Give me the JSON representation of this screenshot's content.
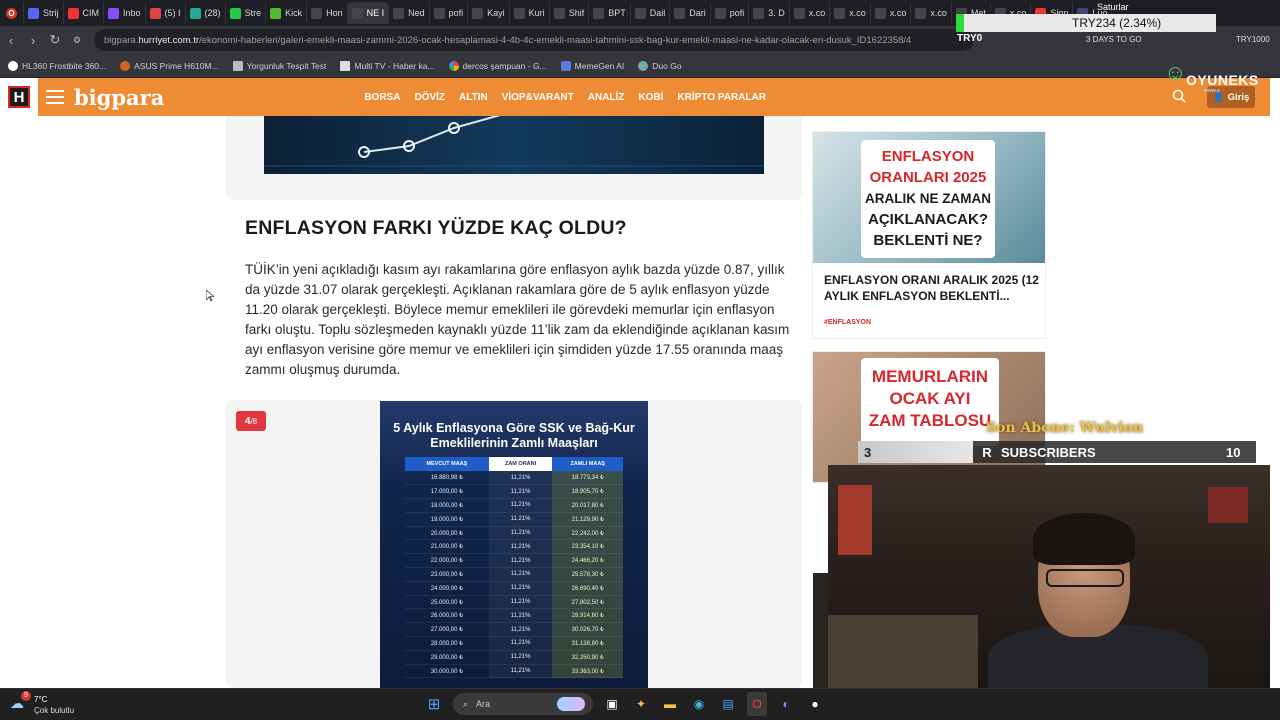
{
  "browser": {
    "tabs": [
      "Strij",
      "CIM",
      "Inbo",
      "(5) I",
      "(28)",
      "Stre",
      "Kick",
      "Hon",
      "NE I",
      "Ned",
      "pofi",
      "Kayi",
      "Kuri",
      "Shif",
      "BPT",
      "Dail",
      "Dari",
      "pofi",
      "3. D",
      "x.co",
      "x.co",
      "x.co",
      "x.co",
      "Met",
      "x.co",
      "Sign",
      "Luo"
    ],
    "url_prefix": "bigpara.",
    "url_domain": "hurriyet.com.tr",
    "url_path": "/ekonomi-haberleri/galeri-emekli-maasi-zammi-2026-ocak-hesaplamasi-4-4b-4c-emekli-maasi-tahmini-ssk-bag-kur-emekli-maasi-ne-kadar-olacak-en-dusuk_ID1622358/4",
    "bookmarks": [
      "HL360 Frostbite 360...",
      "ASUS Prime H610M...",
      "Yorgunluk Tespit Test",
      "Multi TV - Haber ka...",
      "dercos şampuan - G...",
      "MemeGen AI",
      "Duo Go"
    ]
  },
  "site": {
    "logo_letter": "H",
    "brand": "bigpara",
    "nav": [
      "BORSA",
      "DÖVİZ",
      "ALTIN",
      "VİOP&VARANT",
      "ANALİZ",
      "KOBİ",
      "KRİPTO PARALAR"
    ],
    "login": "Giriş"
  },
  "article": {
    "heading": "ENFLASYON FARKI YÜZDE KAÇ OLDU?",
    "paragraph": "TÜİK’in yeni açıkladığı kasım ayı rakamlarına göre enflasyon aylık bazda yüzde 0.87, yıllık da yüzde 31.07 olarak gerçekleşti. Açıklanan rakamlara göre de 5 aylık enflasyon yüzde 11.20 olarak gerçekleşti. Böylece memur emeklileri ile görevdeki memurlar için enflasyon farkı oluştu. Toplu sözleşmeden kaynaklı yüzde 11’lik zam da eklendiğinde açıklanan kasım ayı enflasyon verisine göre memur ve emeklileri için şimdiden yüzde 17.55 oranında maaş zammı oluşmuş durumda.",
    "gallery_index": "4",
    "gallery_total": "/8",
    "poster_title_1": "5 Aylık Enflasyona Göre SSK ve Bağ-Kur",
    "poster_title_2": "Emeklilerinin Zamlı Maaşları",
    "poster_headers": [
      "MEVCUT MAAŞ",
      "ZAM ORANI",
      "ZAMLI MAAŞ"
    ],
    "poster_rows": [
      [
        "16.880,98 ₺",
        "11,21%",
        "18.773,34 ₺"
      ],
      [
        "17.000,00 ₺",
        "11,21%",
        "18.905,70 ₺"
      ],
      [
        "18.000,00 ₺",
        "11,21%",
        "20.017,80 ₺"
      ],
      [
        "19.000,00 ₺",
        "11,21%",
        "21.129,90 ₺"
      ],
      [
        "20.000,00 ₺",
        "11,21%",
        "22.242,00 ₺"
      ],
      [
        "21.000,00 ₺",
        "11,21%",
        "23.354,10 ₺"
      ],
      [
        "22.000,00 ₺",
        "11,21%",
        "24.466,20 ₺"
      ],
      [
        "23.000,00 ₺",
        "11,21%",
        "25.578,30 ₺"
      ],
      [
        "24.000,00 ₺",
        "11,21%",
        "26.690,40 ₺"
      ],
      [
        "25.000,00 ₺",
        "11,21%",
        "27.802,50 ₺"
      ],
      [
        "26.000,00 ₺",
        "11,21%",
        "28.914,60 ₺"
      ],
      [
        "27.000,00 ₺",
        "11,21%",
        "30.026,70 ₺"
      ],
      [
        "28.000,00 ₺",
        "11,21%",
        "31.138,80 ₺"
      ],
      [
        "29.000,00 ₺",
        "11,21%",
        "32.250,90 ₺"
      ],
      [
        "30.000,00 ₺",
        "11,21%",
        "33.363,00 ₺"
      ]
    ]
  },
  "sidebar": {
    "card1_img_lines": [
      "ENFLASYON",
      "ORANLARI 2025",
      "ARALIK NE ZAMAN",
      "AÇIKLANACAK?",
      "BEKLENTİ NE?"
    ],
    "card1_title": "ENFLASYON ORANI ARALIK 2025 (12 AYLIK ENFLASYON BEKLENTİ...",
    "card1_category": "#ENFLASYON",
    "card2_img_lines": [
      "MEMURLARIN",
      "OCAK AYI",
      "ZAM TABLOSU"
    ]
  },
  "stream": {
    "ticker": "TRY234 (2.34%)",
    "ticker_label": "TRY0",
    "days_ago": "3 DAYS TO GO",
    "try_right": "TRY1000",
    "saturlar": "Saturlar",
    "oyuneks": "OYUNEKS",
    "oyuneks_sub": "www.o",
    "son_abone": "Son Abone: Wulvion",
    "sub_left": "3",
    "sub_r": "R",
    "sub_label": "SUBSCRIBERS",
    "sub_right": "10"
  },
  "taskbar": {
    "temp": "7°C",
    "weather": "Çok bulutlu",
    "weather_badge": "9",
    "search": "Ara"
  }
}
